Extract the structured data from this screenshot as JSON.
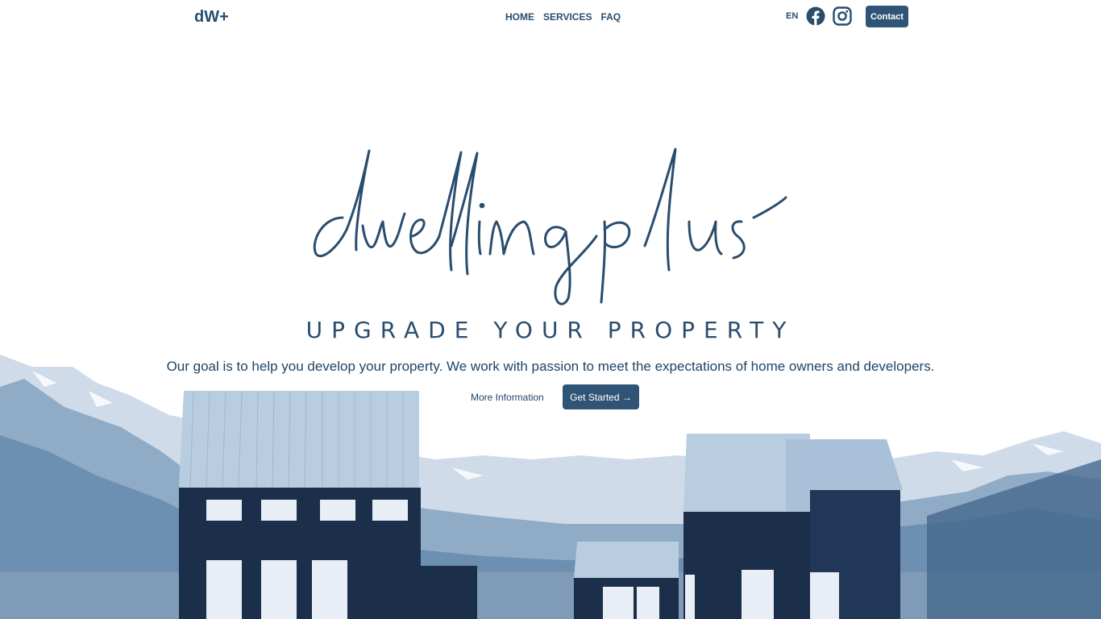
{
  "header": {
    "brand": "dW+",
    "nav": [
      "HOME",
      "SERVICES",
      "FAQ"
    ],
    "lang": "EN",
    "contact_label": "Contact"
  },
  "hero": {
    "logo_text": "dwellingplus",
    "tagline": "UPGRADE YOUR PROPERTY",
    "description": "Our goal is to help you develop your property. We work with passion to meet the expectations of home owners and developers.",
    "more_label": "More Information",
    "start_label": "Get Started →"
  },
  "colors": {
    "primary": "#2f5476",
    "text": "#2a4d6e"
  },
  "icons": {
    "social_1": "facebook-icon",
    "social_2": "instagram-icon"
  }
}
